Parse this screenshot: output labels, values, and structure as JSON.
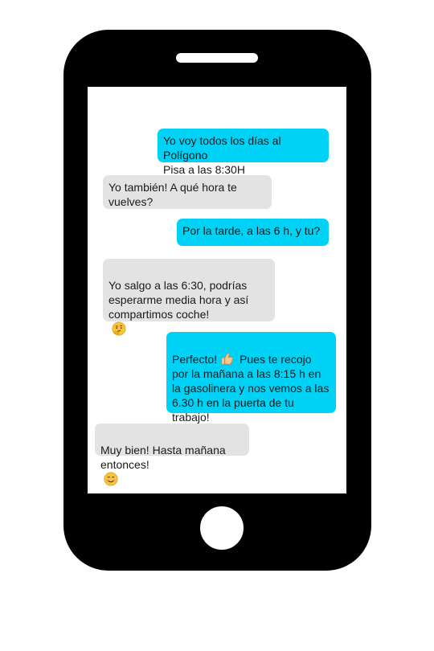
{
  "conversation": {
    "messages": [
      {
        "text": "Yo voy todos los días al Polígono\nPisa a las 8:30H"
      },
      {
        "text": "Yo también! A qué hora te\nvuelves?"
      },
      {
        "text": "Por la tarde, a las 6 h, y tu?"
      },
      {
        "text": "Yo salgo a las 6:30, podrías\nesperarme media hora y así\ncompartimos coche!"
      },
      {
        "text_a": "Perfecto!",
        "text_b": "Pues te recojo\npor la mañana a las 8:15 h en\nla gasolinera y nos vemos a las\n6.30 h en la puerta de tu\ntrabajo!"
      },
      {
        "text": "Muy bien! Hasta mañana\nentonces!"
      }
    ]
  },
  "colors": {
    "phone_body": "#000000",
    "screen": "#ffffff",
    "sent_bubble": "#00d2f6",
    "received_bubble": "#e3e3e3"
  },
  "icons": {
    "thinking": "thinking-face-icon",
    "thumbs_up": "thumbs-up-icon",
    "smile": "smiling-face-icon"
  }
}
